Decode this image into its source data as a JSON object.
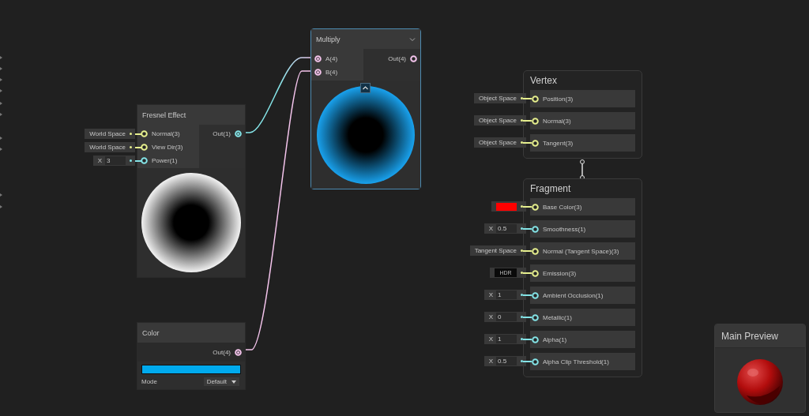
{
  "fresnel_node": {
    "title": "Fresnel Effect",
    "inputs": [
      {
        "label": "Normal(3)",
        "color": "#e6ef8e",
        "connected": false,
        "default": {
          "kind": "space",
          "text": "World Space"
        }
      },
      {
        "label": "View Dir(3)",
        "color": "#e6ef8e",
        "connected": false,
        "default": {
          "kind": "space",
          "text": "World Space"
        }
      },
      {
        "label": "Power(1)",
        "color": "#84e4e7",
        "connected": false,
        "default": {
          "kind": "float",
          "axis": "X",
          "value": "3"
        }
      }
    ],
    "outputs": [
      {
        "label": "Out(1)",
        "color": "#84e4e7",
        "connected": true
      }
    ]
  },
  "multiply_node": {
    "title": "Multiply",
    "selected": true,
    "inputs": [
      {
        "label": "A(4)",
        "color": "#f4c4ec",
        "connected": true
      },
      {
        "label": "B(4)",
        "color": "#f4c4ec",
        "connected": true
      }
    ],
    "outputs": [
      {
        "label": "Out(4)",
        "color": "#f4c4ec",
        "connected": false
      }
    ]
  },
  "color_node": {
    "title": "Color",
    "outputs": [
      {
        "label": "Out(4)",
        "color": "#f4c4ec",
        "connected": true
      }
    ],
    "color": "#00aaee",
    "mode_label": "Mode",
    "mode": "Default"
  },
  "vertex_block": {
    "title": "Vertex",
    "inputs": [
      {
        "label": "Position(3)",
        "color": "#e6ef8e",
        "default": {
          "kind": "space",
          "text": "Object Space"
        }
      },
      {
        "label": "Normal(3)",
        "color": "#e6ef8e",
        "default": {
          "kind": "space",
          "text": "Object Space"
        }
      },
      {
        "label": "Tangent(3)",
        "color": "#e6ef8e",
        "default": {
          "kind": "space",
          "text": "Object Space"
        }
      }
    ]
  },
  "fragment_block": {
    "title": "Fragment",
    "inputs": [
      {
        "label": "Base Color(3)",
        "color": "#e6ef8e",
        "default": {
          "kind": "color",
          "color": "#ff0000"
        }
      },
      {
        "label": "Smoothness(1)",
        "color": "#84e4e7",
        "default": {
          "kind": "float",
          "axis": "X",
          "value": "0.5"
        }
      },
      {
        "label": "Normal (Tangent Space)(3)",
        "color": "#e6ef8e",
        "default": {
          "kind": "space",
          "text": "Tangent Space"
        }
      },
      {
        "label": "Emission(3)",
        "color": "#e6ef8e",
        "default": {
          "kind": "hdr",
          "text": "HDR"
        }
      },
      {
        "label": "Ambient Occlusion(1)",
        "color": "#84e4e7",
        "default": {
          "kind": "float",
          "axis": "X",
          "value": "1"
        }
      },
      {
        "label": "Metallic(1)",
        "color": "#84e4e7",
        "default": {
          "kind": "float",
          "axis": "X",
          "value": "0"
        }
      },
      {
        "label": "Alpha(1)",
        "color": "#84e4e7",
        "default": {
          "kind": "float",
          "axis": "X",
          "value": "1"
        }
      },
      {
        "label": "Alpha Clip Threshold(1)",
        "color": "#84e4e7",
        "default": {
          "kind": "float",
          "axis": "X",
          "value": "0.5"
        }
      }
    ]
  },
  "main_preview": {
    "title": "Main Preview"
  }
}
